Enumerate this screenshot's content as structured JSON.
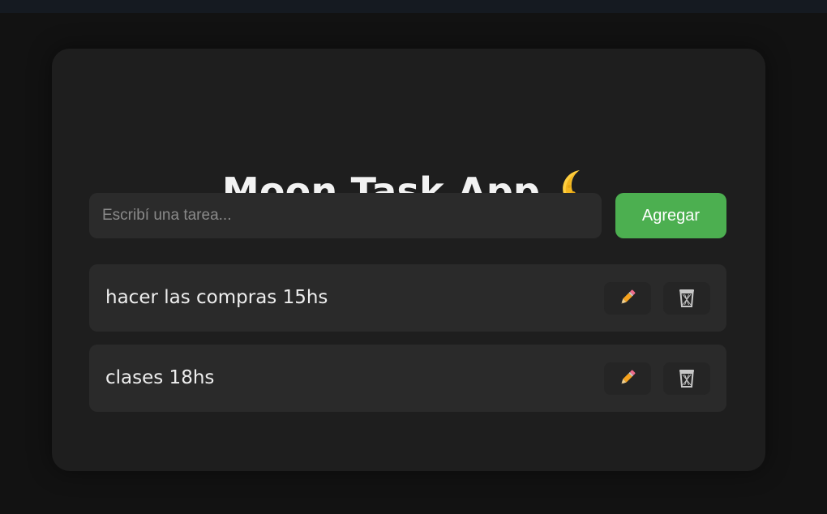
{
  "app": {
    "title": "Moon Task App"
  },
  "form": {
    "placeholder": "Escribí una tarea...",
    "value": "",
    "add_label": "Agregar"
  },
  "tasks": [
    {
      "text": "hacer las compras 15hs",
      "edit_icon": "pencil-icon",
      "delete_icon": "trash-icon"
    },
    {
      "text": "clases 18hs",
      "edit_icon": "pencil-icon",
      "delete_icon": "trash-icon"
    }
  ],
  "colors": {
    "page_background": "#121212",
    "card_background": "#1e1e1e",
    "accent_green": "#4caf50",
    "task_background": "#2a2a2a"
  }
}
